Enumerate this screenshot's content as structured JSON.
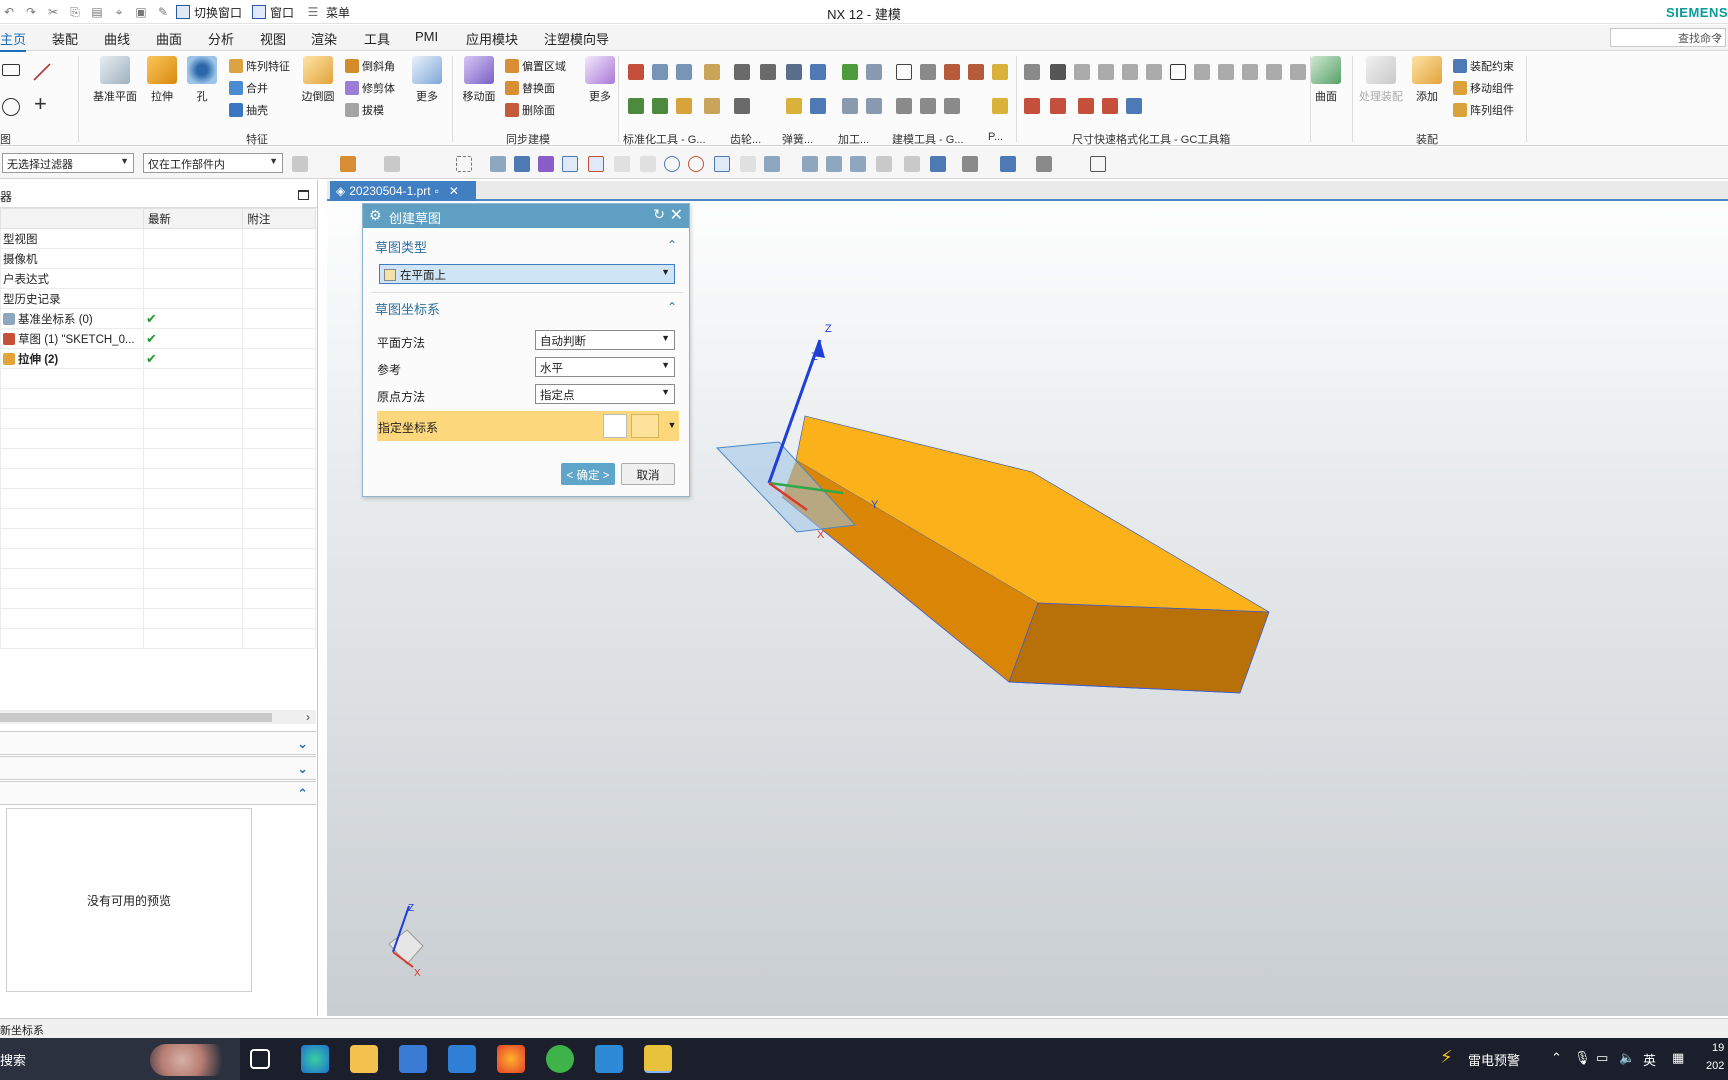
{
  "window": {
    "title": "NX 12 - 建模",
    "brand": "SIEMENS"
  },
  "quick_access": {
    "switch_window": "切换窗口",
    "window": "窗口",
    "menu": "菜单"
  },
  "menu_tabs": [
    "主页",
    "装配",
    "曲线",
    "曲面",
    "分析",
    "视图",
    "渲染",
    "工具",
    "PMI",
    "应用模块",
    "注塑模向导"
  ],
  "search_placeholder": "查找命令",
  "ribbon": {
    "feature": {
      "datum_plane": "基准平面",
      "extrude": "拉伸",
      "hole": "孔",
      "pattern": "阵列特征",
      "unite": "合并",
      "shell": "抽壳",
      "edge_blend": "边倒圆",
      "chamfer": "倒斜角",
      "trim_body": "修剪体",
      "draft": "拔模",
      "more": "更多",
      "group": "特征"
    },
    "sync": {
      "move_face": "移动面",
      "offset_region": "偏置区域",
      "replace_face": "替换面",
      "delete_face": "删除面",
      "more": "更多",
      "group": "同步建模"
    },
    "groups": {
      "std_tools": "标准化工具 - G...",
      "gear": "齿轮...",
      "spring": "弹簧...",
      "machining": "加工...",
      "modeling_tools": "建模工具 - G...",
      "p": "P...",
      "dim_tools": "尺寸快速格式化工具 - GC工具箱",
      "sketch_left": "图"
    },
    "surface": {
      "label": "曲面"
    },
    "assembly": {
      "process": "处理装配",
      "add": "添加",
      "constraint": "装配约束",
      "move": "移动组件",
      "pattern": "阵列组件",
      "group": "装配"
    }
  },
  "filters": {
    "selection": "无选择过滤器",
    "scope": "仅在工作部件内"
  },
  "navigator": {
    "header": "器",
    "columns": [
      "",
      "最新",
      "附注"
    ],
    "rows": [
      {
        "name": "型视图",
        "check": ""
      },
      {
        "name": "摄像机",
        "check": ""
      },
      {
        "name": "户表达式",
        "check": ""
      },
      {
        "name": "型历史记录",
        "check": ""
      },
      {
        "name": "基准坐标系 (0)",
        "check": "✔"
      },
      {
        "name": "草图 (1) \"SKETCH_0...",
        "check": "✔"
      },
      {
        "name": "拉伸 (2)",
        "check": "✔"
      }
    ],
    "preview_text": "没有可用的预览"
  },
  "doc_tab": {
    "label": "20230504-1.prt"
  },
  "dialog": {
    "title": "创建草图",
    "section1": "草图类型",
    "type_value": "在平面上",
    "section2": "草图坐标系",
    "plane_method_label": "平面方法",
    "plane_method_value": "自动判断",
    "reference_label": "参考",
    "reference_value": "水平",
    "origin_label": "原点方法",
    "origin_value": "指定点",
    "csys_label": "指定坐标系",
    "ok": "< 确定 >",
    "cancel": "取消"
  },
  "axes": {
    "x": "X",
    "y": "Y",
    "z": "Z"
  },
  "status": {
    "text": "新坐标系"
  },
  "taskbar": {
    "search": "搜索",
    "weather": "雷电预警",
    "ime": "英",
    "clock_time": "19",
    "clock_date": "202"
  },
  "colors": {
    "accent": "#1d6fb8",
    "dialog_title": "#5e9fc2",
    "highlight": "#fcd77c",
    "solid_top": "#fbb21a",
    "solid_side": "#d98606",
    "solid_front": "#b87008"
  }
}
